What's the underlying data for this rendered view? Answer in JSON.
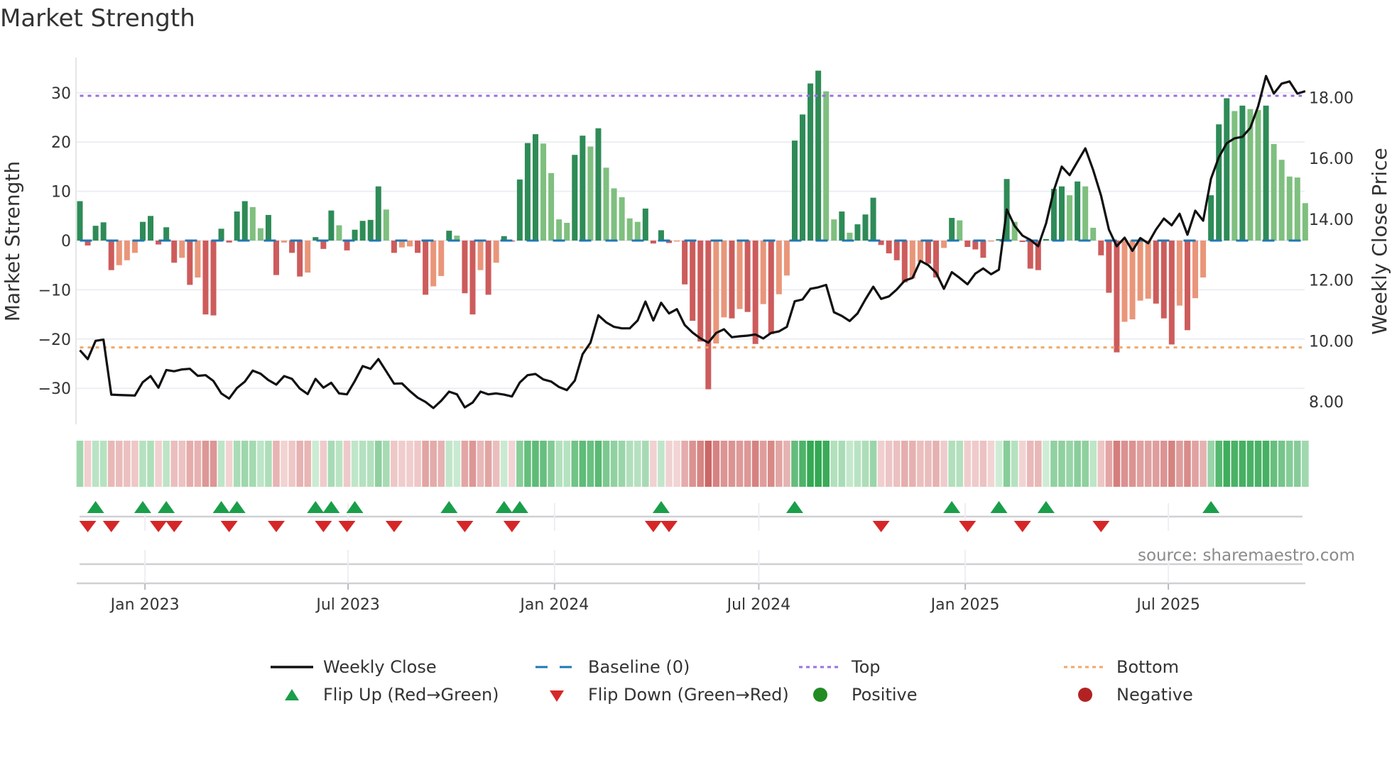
{
  "title": "Market Strength",
  "source_note": "source: sharemaestro.com",
  "chart_data": {
    "type": "bar+line",
    "title": "Market Strength",
    "ylabel": "Market Strength",
    "y2label": "Weekly Close Price",
    "frequency": "weekly",
    "start_date": "2022-11-04",
    "ylim": [
      -37.5,
      37
    ],
    "y2lim": [
      7.2,
      19.3
    ],
    "grid": true,
    "legend_position": "bottom",
    "top_level": 29.4,
    "bottom_level": -21.7,
    "baseline": 0,
    "left_ticks": [
      {
        "v": -30,
        "label": "−30"
      },
      {
        "v": -20,
        "label": "−20"
      },
      {
        "v": -10,
        "label": "−10"
      },
      {
        "v": 0,
        "label": "0"
      },
      {
        "v": 10,
        "label": "10"
      },
      {
        "v": 20,
        "label": "20"
      },
      {
        "v": 30,
        "label": "30"
      }
    ],
    "right_ticks": [
      {
        "v": 8,
        "label": "8.00"
      },
      {
        "v": 10,
        "label": "10.00"
      },
      {
        "v": 12,
        "label": "12.00"
      },
      {
        "v": 14,
        "label": "14.00"
      },
      {
        "v": 16,
        "label": "16.00"
      },
      {
        "v": 18,
        "label": "18.00"
      }
    ],
    "x_ticks": [
      {
        "date": "2023-01-01",
        "label": "Jan 2023"
      },
      {
        "date": "2023-07-01",
        "label": "Jul 2023"
      },
      {
        "date": "2024-01-01",
        "label": "Jan 2024"
      },
      {
        "date": "2024-07-01",
        "label": "Jul 2024"
      },
      {
        "date": "2025-01-01",
        "label": "Jan 2025"
      },
      {
        "date": "2025-07-01",
        "label": "Jul 2025"
      }
    ],
    "strength": [
      8,
      -1,
      3,
      3.7,
      -6,
      -5,
      -4,
      -2.5,
      3.8,
      5,
      -0.8,
      2.7,
      -4.5,
      -3.5,
      -9,
      -7.5,
      -15,
      -15.2,
      2.4,
      -0.4,
      5.9,
      8,
      6.8,
      2.5,
      5.2,
      -7,
      -0.4,
      -2.5,
      -7.3,
      -6.5,
      0.7,
      -1.7,
      6.1,
      3.1,
      -2,
      2.2,
      4,
      4.2,
      11,
      6.3,
      -2.5,
      -1.4,
      -1.2,
      -2.5,
      -11,
      -9.3,
      -7.2,
      2,
      1,
      -10.7,
      -15,
      -6,
      -11,
      -4.5,
      0.9,
      -0.2,
      12.4,
      19.8,
      21.6,
      19.7,
      13.7,
      4.3,
      3.6,
      17.4,
      21.3,
      19.1,
      22.8,
      14.8,
      10.6,
      8.8,
      4.5,
      3.8,
      6.5,
      -0.6,
      2.1,
      -0.5,
      -0.2,
      -8.9,
      -16.3,
      -20.5,
      -30.2,
      -20.9,
      -15.6,
      -15.8,
      -13.9,
      -14.5,
      -21,
      -12.9,
      -19,
      -10.9,
      -7.1,
      20.3,
      25.6,
      31.9,
      34.5,
      30.3,
      4.3,
      5.9,
      1.6,
      3.3,
      5.3,
      8.7,
      -0.9,
      -2.6,
      -4,
      -8.5,
      -7.7,
      -4.3,
      -4.7,
      -7.5,
      -1.5,
      4.6,
      4.1,
      -1.3,
      -1.8,
      -3.5,
      -0.2,
      0.3,
      12.5,
      3.8,
      -0.3,
      -5.7,
      -6,
      0.3,
      10.5,
      11,
      9.2,
      12,
      11,
      2.6,
      -3,
      -10.6,
      -22.7,
      -16.5,
      -16,
      -12.2,
      -11.8,
      -12.8,
      -15.8,
      -21.1,
      -13.2,
      -18.2,
      -11.7,
      -7.5,
      9.2,
      23.6,
      28.9,
      26.3,
      27.4,
      26.7,
      26.5,
      27.4,
      19.6,
      16.4,
      13,
      12.8,
      7.6
    ],
    "weekly_close": [
      9.69,
      9.4,
      10.0,
      10.04,
      8.23,
      8.22,
      8.21,
      8.2,
      8.64,
      8.84,
      8.46,
      9.04,
      9.0,
      9.06,
      9.08,
      8.85,
      8.87,
      8.68,
      8.27,
      8.1,
      8.45,
      8.66,
      9.02,
      8.92,
      8.71,
      8.56,
      8.84,
      8.75,
      8.43,
      8.25,
      8.75,
      8.46,
      8.62,
      8.27,
      8.24,
      8.68,
      9.17,
      9.08,
      9.4,
      9.0,
      8.59,
      8.6,
      8.35,
      8.13,
      7.99,
      7.79,
      8.03,
      8.33,
      8.24,
      7.81,
      7.97,
      8.33,
      8.24,
      8.27,
      8.23,
      8.17,
      8.63,
      8.87,
      8.91,
      8.73,
      8.66,
      8.48,
      8.38,
      8.69,
      9.56,
      9.94,
      10.84,
      10.61,
      10.46,
      10.41,
      10.41,
      10.67,
      11.29,
      10.67,
      11.25,
      10.9,
      11.04,
      10.52,
      10.27,
      10.08,
      9.94,
      10.26,
      10.38,
      10.12,
      10.15,
      10.17,
      10.21,
      10.08,
      10.26,
      10.31,
      10.46,
      11.3,
      11.36,
      11.71,
      11.76,
      11.84,
      10.94,
      10.82,
      10.65,
      10.9,
      11.36,
      11.78,
      11.38,
      11.46,
      11.69,
      11.98,
      12.07,
      12.63,
      12.49,
      12.24,
      11.71,
      12.26,
      12.07,
      11.86,
      12.21,
      12.38,
      12.19,
      12.34,
      14.32,
      13.78,
      13.46,
      13.32,
      13.11,
      13.86,
      14.95,
      15.73,
      15.45,
      15.89,
      16.33,
      15.62,
      14.78,
      13.66,
      13.11,
      13.39,
      12.96,
      13.38,
      13.21,
      13.66,
      14.02,
      13.8,
      14.18,
      13.49,
      14.28,
      13.95,
      15.33,
      16.04,
      16.5,
      16.66,
      16.71,
      17.0,
      17.71,
      18.71,
      18.13,
      18.46,
      18.53,
      18.13,
      18.21
    ],
    "flip_up_weeks": [
      2,
      8,
      11,
      18,
      20,
      30,
      32,
      35,
      47,
      54,
      56,
      74,
      91,
      111,
      117,
      123,
      144
    ],
    "flip_down_weeks": [
      1,
      4,
      10,
      12,
      19,
      25,
      31,
      34,
      40,
      49,
      55,
      73,
      75,
      102,
      113,
      120,
      130
    ]
  },
  "legend": [
    {
      "label": "Weekly Close",
      "symbol": "solid-line",
      "color": "#111111"
    },
    {
      "label": "Baseline (0)",
      "symbol": "dashed-line",
      "color": "#1f77b4"
    },
    {
      "label": "Top",
      "symbol": "dotted-line",
      "color": "#9b6fe0"
    },
    {
      "label": "Bottom",
      "symbol": "dotted-line",
      "color": "#f0a868"
    },
    {
      "label": "Flip Up (Red→Green)",
      "symbol": "triangle-up",
      "color": "#1a9e4a"
    },
    {
      "label": "Flip Down (Green→Red)",
      "symbol": "triangle-down",
      "color": "#d62728"
    },
    {
      "label": "Positive",
      "symbol": "dot",
      "color": "#228b22"
    },
    {
      "label": "Negative",
      "symbol": "dot",
      "color": "#b22222"
    }
  ],
  "colors": {
    "pos_strong": "#2e8b57",
    "pos_weak": "#7fbf7f",
    "neg_strong": "#cd5c5c",
    "neg_weak": "#e9967a",
    "line": "#111111",
    "top": "#9b6fe0",
    "bottom": "#f0a868",
    "baseline": "#1f77b4",
    "flip_up": "#1a9e4a",
    "flip_down": "#d62728",
    "grid": "#eceef3"
  }
}
